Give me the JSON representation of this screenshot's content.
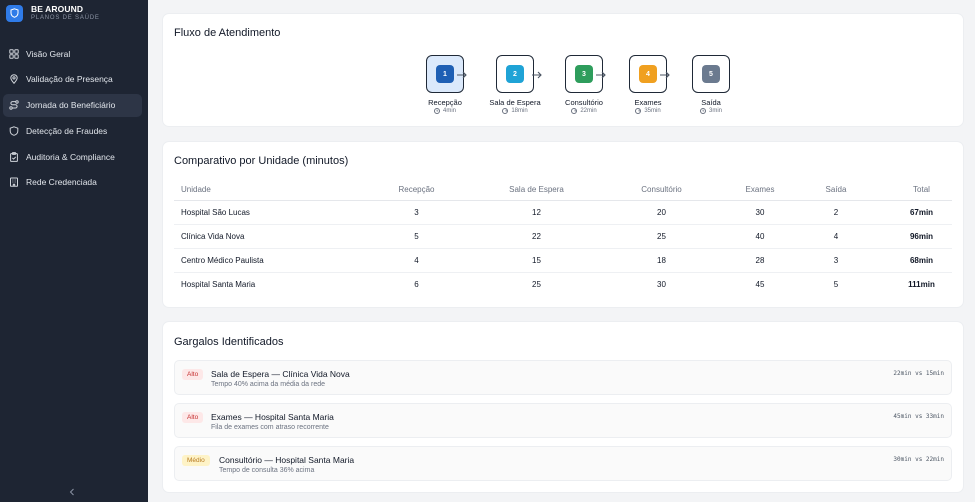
{
  "brand": {
    "name": "BE AROUND",
    "subtitle": "PLANOS DE SAÚDE",
    "accent": "#2f7be8"
  },
  "sidebar": {
    "items": [
      {
        "label": "Visão Geral",
        "icon": "grid-icon",
        "active": false
      },
      {
        "label": "Validação de Presença",
        "icon": "location-pin-icon",
        "active": false
      },
      {
        "label": "Jornada do Beneficiário",
        "icon": "route-icon",
        "active": true
      },
      {
        "label": "Detecção de Fraudes",
        "icon": "shield-icon",
        "active": false
      },
      {
        "label": "Auditoria & Compliance",
        "icon": "clipboard-icon",
        "active": false
      },
      {
        "label": "Rede Credenciada",
        "icon": "building-icon",
        "active": false
      }
    ],
    "collapse_icon": "chevron-left-icon"
  },
  "flow": {
    "title": "Fluxo de Atendimento",
    "steps": [
      {
        "number": "1",
        "label": "Recepção",
        "time": "4min",
        "color": "#1e5fb4",
        "active": true
      },
      {
        "number": "2",
        "label": "Sala de Espera",
        "time": "18min",
        "color": "#1fa3d6",
        "active": false
      },
      {
        "number": "3",
        "label": "Consultório",
        "time": "22min",
        "color": "#2e9d5c",
        "active": false
      },
      {
        "number": "4",
        "label": "Exames",
        "time": "35min",
        "color": "#f0a020",
        "active": false
      },
      {
        "number": "5",
        "label": "Saída",
        "time": "3min",
        "color": "#6b7a8f",
        "active": false
      }
    ]
  },
  "comparison": {
    "title": "Comparativo por Unidade (minutos)",
    "columns": [
      "Unidade",
      "Recepção",
      "Sala de Espera",
      "Consultório",
      "Exames",
      "Saída",
      "Total"
    ],
    "rows": [
      [
        "Hospital São Lucas",
        "3",
        "12",
        "20",
        "30",
        "2",
        "67min"
      ],
      [
        "Clínica Vida Nova",
        "5",
        "22",
        "25",
        "40",
        "4",
        "96min"
      ],
      [
        "Centro Médico Paulista",
        "4",
        "15",
        "18",
        "28",
        "3",
        "68min"
      ],
      [
        "Hospital Santa Maria",
        "6",
        "25",
        "30",
        "45",
        "5",
        "111min"
      ]
    ]
  },
  "bottlenecks": {
    "title": "Gargalos Identificados",
    "items": [
      {
        "severity": "Alto",
        "level": "high",
        "title": "Sala de Espera — Clínica Vida Nova",
        "description": "Tempo 40% acima da média da rede",
        "compare": "22min vs 15min"
      },
      {
        "severity": "Alto",
        "level": "high",
        "title": "Exames — Hospital Santa Maria",
        "description": "Fila de exames com atraso recorrente",
        "compare": "45min vs 33min"
      },
      {
        "severity": "Médio",
        "level": "mid",
        "title": "Consultório — Hospital Santa Maria",
        "description": "Tempo de consulta 36% acima",
        "compare": "30min vs 22min"
      }
    ]
  }
}
